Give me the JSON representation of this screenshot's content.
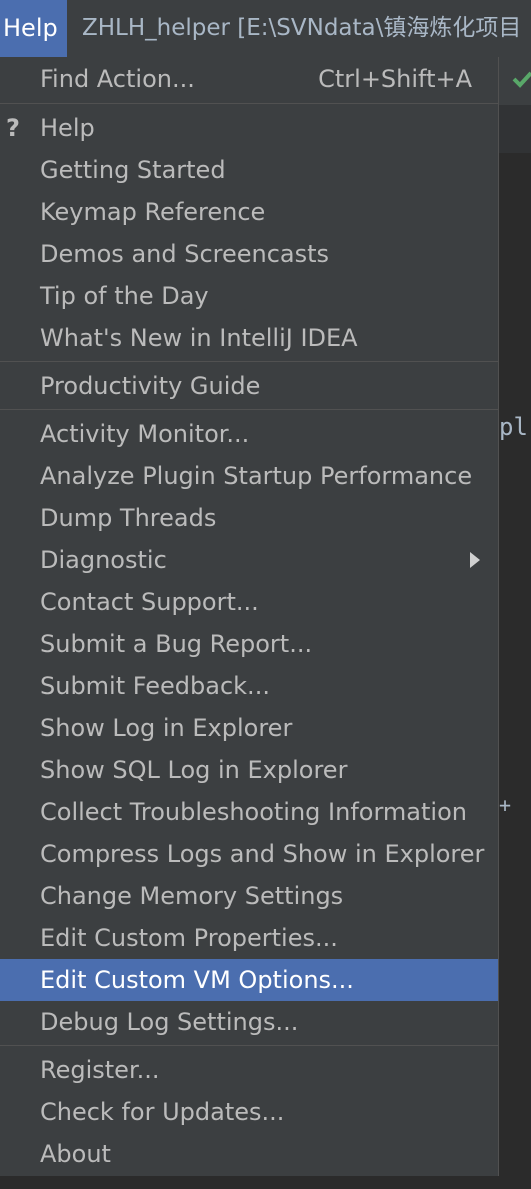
{
  "menubar": {
    "help_label": "Help"
  },
  "window_title": "ZHLH_helper [E:\\SVNdata\\镇海炼化项目",
  "editor": {
    "code_fragment": "pl",
    "plus_fragment": "+"
  },
  "menu": {
    "find_action": {
      "label": "Find Action...",
      "shortcut": "Ctrl+Shift+A"
    },
    "group1": [
      "Help",
      "Getting Started",
      "Keymap Reference",
      "Demos and Screencasts",
      "Tip of the Day",
      "What's New in IntelliJ IDEA"
    ],
    "group2": [
      "Productivity Guide"
    ],
    "group3": [
      "Activity Monitor...",
      "Analyze Plugin Startup Performance",
      "Dump Threads",
      "Diagnostic",
      "Contact Support...",
      "Submit a Bug Report...",
      "Submit Feedback...",
      "Show Log in Explorer",
      "Show SQL Log in Explorer",
      "Collect Troubleshooting Information",
      "Compress Logs and Show in Explorer",
      "Change Memory Settings",
      "Edit Custom Properties...",
      "Edit Custom VM Options...",
      "Debug Log Settings..."
    ],
    "group4": [
      "Register...",
      "Check for Updates...",
      "About"
    ]
  },
  "colors": {
    "menu_bg": "#3c3f41",
    "selection": "#4b6eaf",
    "text": "#bbbbbb",
    "separator": "#515151"
  }
}
